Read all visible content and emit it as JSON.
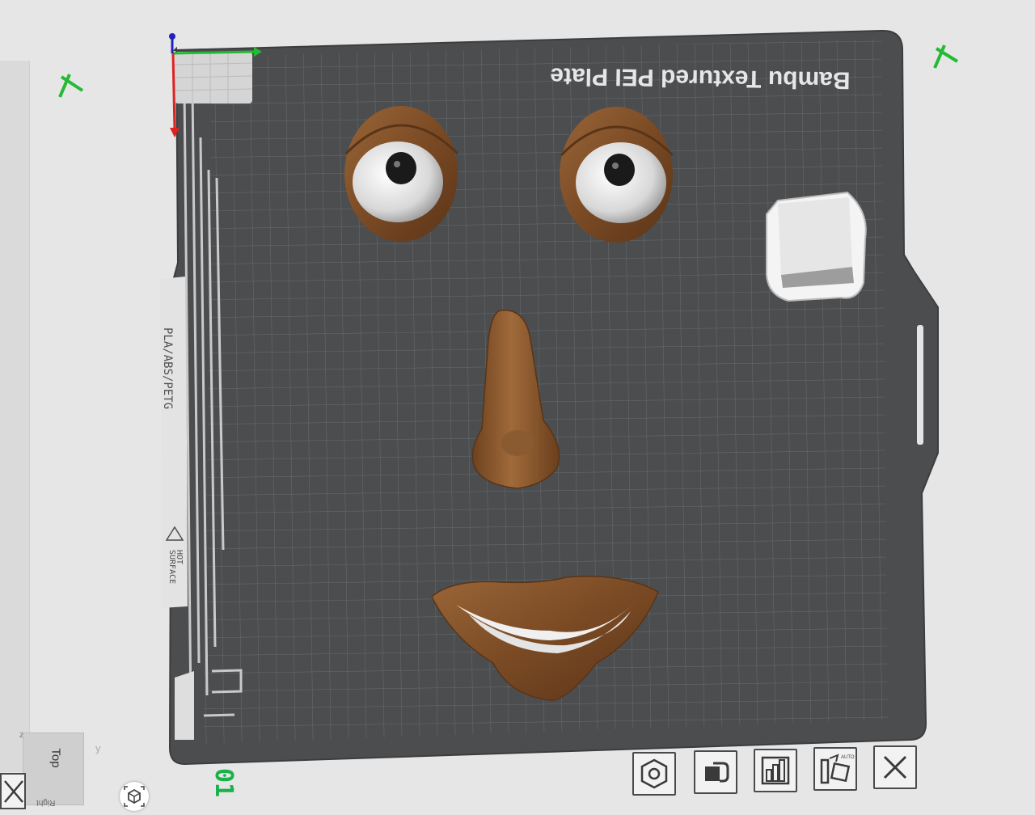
{
  "plate": {
    "name_label": "Bambu Textured PEI Plate",
    "filament_label": "PLA/ABS/PETG",
    "warning_label_line1": "HOT",
    "warning_label_line2": "SURFACE",
    "plate_number": "01"
  },
  "view_cube": {
    "top_label": "Top",
    "right_label": "Right",
    "axis_z": "z",
    "axis_y": "y"
  },
  "plate_toolbar": {
    "buttons": [
      {
        "icon": "arrange-objects-icon"
      },
      {
        "icon": "lock-plate-icon"
      },
      {
        "icon": "plate-settings-icon"
      },
      {
        "icon": "auto-orient-icon",
        "badge": "AUTO"
      },
      {
        "icon": "close-icon"
      }
    ]
  },
  "objects": [
    {
      "name": "left-eye",
      "color": "#7a4a24"
    },
    {
      "name": "right-eye",
      "color": "#7a4a24"
    },
    {
      "name": "nose",
      "color": "#8a5a30"
    },
    {
      "name": "mouth",
      "color": "#7a4a24"
    },
    {
      "name": "wipe-tower",
      "color": "#e8e8e8"
    }
  ],
  "colors": {
    "plate": "#4b4d4f",
    "grid": "#6a6d70",
    "axis_x": "#22bb33",
    "axis_y": "#dd2222",
    "axis_z": "#2222bb",
    "plate_number": "#19b24a"
  }
}
